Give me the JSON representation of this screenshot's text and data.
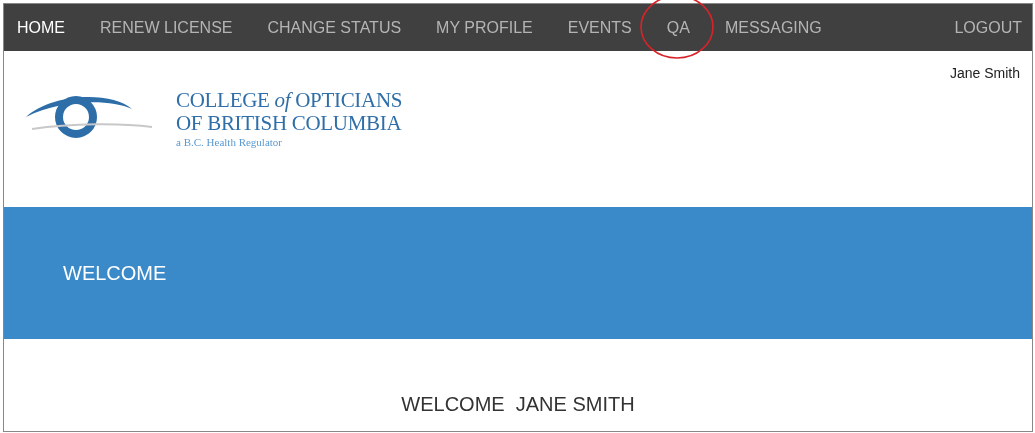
{
  "nav": {
    "items": [
      {
        "label": "HOME",
        "selected": true,
        "highlighted": false
      },
      {
        "label": "RENEW LICENSE",
        "selected": false,
        "highlighted": false
      },
      {
        "label": "CHANGE STATUS",
        "selected": false,
        "highlighted": false
      },
      {
        "label": "MY PROFILE",
        "selected": false,
        "highlighted": false
      },
      {
        "label": "EVENTS",
        "selected": false,
        "highlighted": false
      },
      {
        "label": "QA",
        "selected": false,
        "highlighted": true
      },
      {
        "label": "MESSAGING",
        "selected": false,
        "highlighted": false
      }
    ],
    "logout": "LOGOUT"
  },
  "header": {
    "user_name": "Jane Smith",
    "logo_lines": [
      "COLLEGE *of* OPTICIANS",
      "OF BRITISH COLUMBIA"
    ],
    "logo_tagline": "a B.C. Health Regulator"
  },
  "banner": {
    "title": "WELCOME"
  },
  "greeting": "WELCOME  JANE SMITH"
}
